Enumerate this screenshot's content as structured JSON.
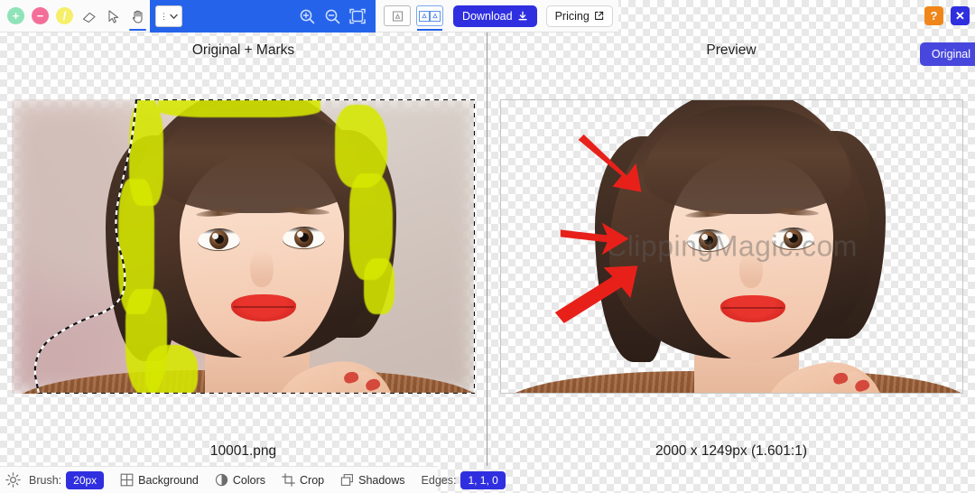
{
  "app": {
    "name": "ClippingMagic",
    "watermark": "ClippingMagic.com"
  },
  "toolbar": {
    "tools": [
      {
        "name": "add-keep-tool",
        "icon": "plus-circle-green",
        "glyph": "+",
        "active": false
      },
      {
        "name": "remove-tool",
        "icon": "minus-circle-pink",
        "glyph": "−",
        "active": false
      },
      {
        "name": "hair-tool",
        "icon": "slash-circle-yellow",
        "glyph": "/",
        "active": false
      },
      {
        "name": "eraser-tool",
        "icon": "eraser-icon",
        "active": false
      },
      {
        "name": "pointer-tool",
        "icon": "cursor-icon",
        "active": false
      },
      {
        "name": "pan-tool",
        "icon": "hand-icon",
        "active": true
      }
    ],
    "brush_stepper_value": "",
    "zoom_in_label": "Zoom in",
    "zoom_out_label": "Zoom out",
    "fit_label": "Fit to screen",
    "view_single_label": "Single view",
    "view_split_label": "Split view",
    "download_label": "Download",
    "pricing_label": "Pricing",
    "help_label": "?",
    "close_label": "✕",
    "accent_blue": "#2563eb",
    "button_blue": "#2f2fe0",
    "help_orange": "#f0861a"
  },
  "left_pane": {
    "title": "Original + Marks",
    "caption": "10001.png"
  },
  "right_pane": {
    "title": "Preview",
    "caption": "2000 x 1249px (1.601:1)",
    "original_button": "Original"
  },
  "bottombar": {
    "settings_label": "Settings",
    "brush_label": "Brush:",
    "brush_value": "20px",
    "background_label": "Background",
    "colors_label": "Colors",
    "crop_label": "Crop",
    "shadows_label": "Shadows",
    "edges_label": "Edges:",
    "edges_value": "1, 1, 0"
  }
}
